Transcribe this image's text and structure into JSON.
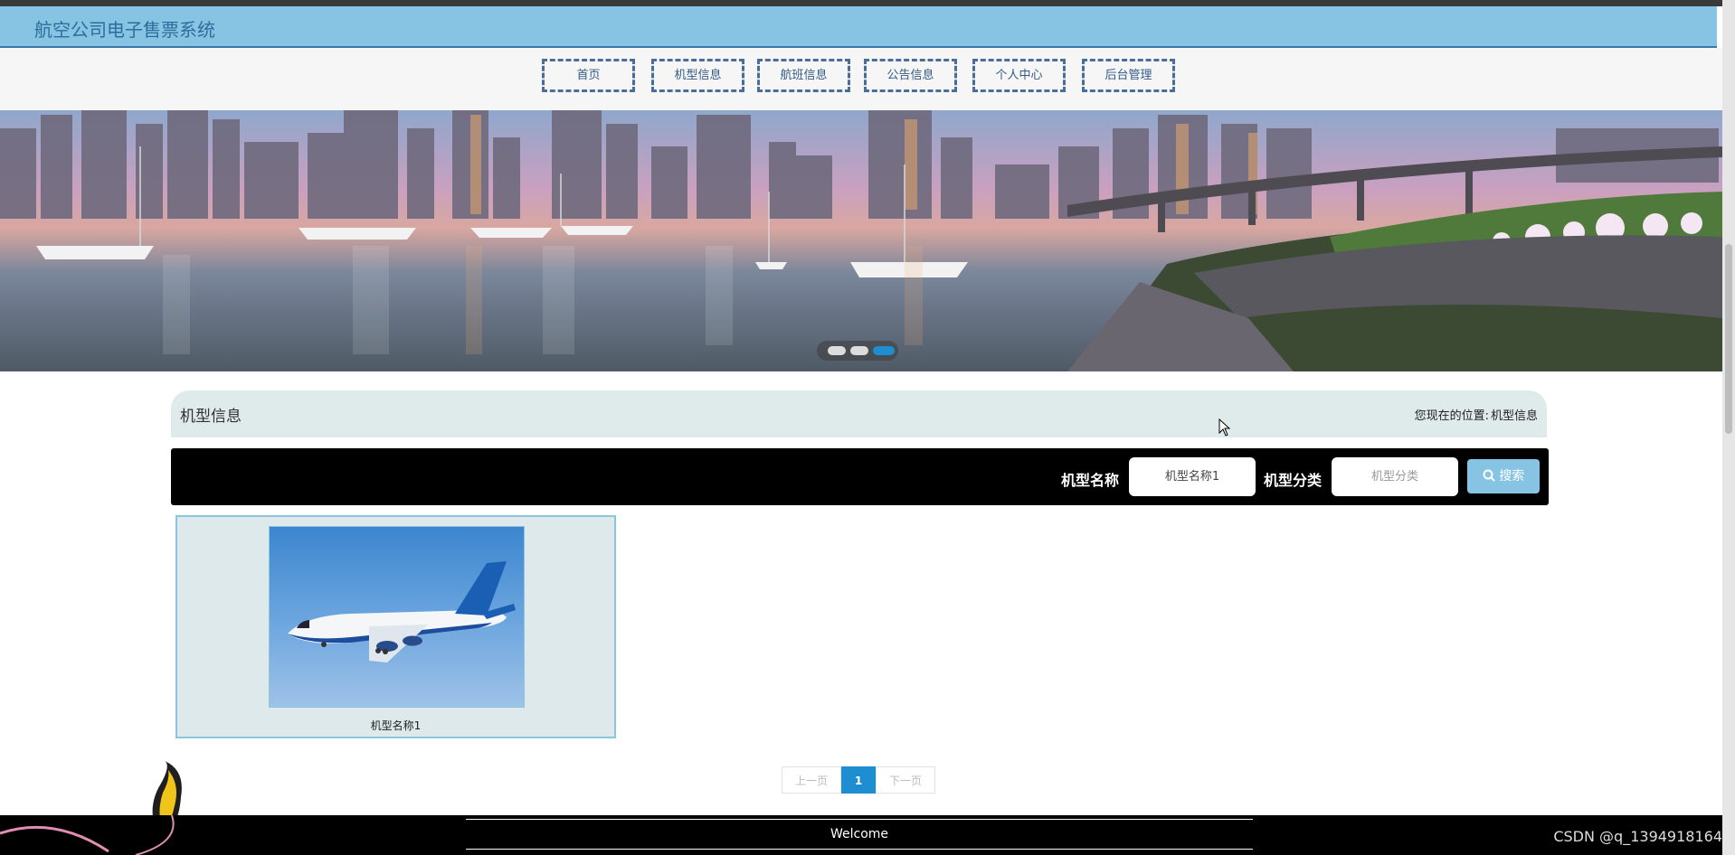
{
  "header": {
    "site_title": "航空公司电子售票系统"
  },
  "nav": {
    "items": [
      {
        "label": "首页"
      },
      {
        "label": "机型信息"
      },
      {
        "label": "航班信息"
      },
      {
        "label": "公告信息"
      },
      {
        "label": "个人中心"
      },
      {
        "label": "后台管理"
      }
    ]
  },
  "banner": {
    "slides": 3,
    "active_slide": 3
  },
  "breadcrumb": {
    "title": "机型信息",
    "location_label": "您现在的位置:",
    "location_value": "机型信息"
  },
  "search": {
    "name_label": "机型名称",
    "name_value": "机型名称1",
    "category_label": "机型分类",
    "category_placeholder": "机型分类",
    "button_label": "搜索"
  },
  "results": [
    {
      "name": "机型名称1",
      "image_icon": "airplane-image"
    }
  ],
  "pagination": {
    "prev_label": "上一页",
    "current_page": "1",
    "next_label": "下一页"
  },
  "footer": {
    "welcome": "Welcome",
    "watermark": "CSDN @q_1394918164"
  },
  "colors": {
    "accent": "#87c4e3",
    "nav_border": "#4a6e99",
    "page_active": "#1e8ed0"
  }
}
